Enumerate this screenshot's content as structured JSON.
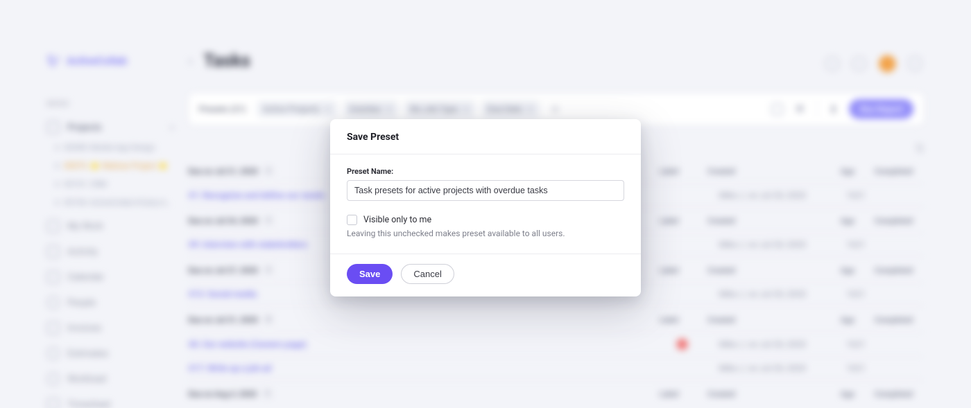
{
  "brand": "ActiveCollab",
  "page_title": "Tasks",
  "menu_label": "MENU",
  "nav": {
    "projects": "Projects",
    "sub": [
      "#2098: Mobile App Design",
      "#3075: ⭐ Webinar Project ⭐",
      "#3151: CRM",
      "#3194: ActiveCollab 8 Early A…"
    ],
    "my_work": "My Work",
    "activity": "Activity",
    "calendar": "Calendar",
    "people": "People",
    "invoices": "Invoices",
    "estimates": "Estimates",
    "workload": "Workload",
    "timesheet": "Timesheet"
  },
  "filter_bar": {
    "presets": "Presets (21)",
    "chips": [
      "Active Projects",
      "Overdue",
      "No Job Type",
      "Due Date"
    ],
    "run_report": "Run Report"
  },
  "columns": {
    "label": "Label",
    "created": "Created",
    "age": "Age",
    "completed": "Completed"
  },
  "groups": [
    {
      "title": "Due on Jul 21, 2020",
      "count": "1",
      "rows": [
        {
          "name": "#1: Recognize and define our needs",
          "created": "Mike J. on Jul 20, 2020",
          "age": "1621"
        }
      ]
    },
    {
      "title": "Due on Jul 24, 2020",
      "count": "1",
      "rows": [
        {
          "name": "#9: Interview with stakeholders",
          "created": "Mike J. on Jul 20, 2020",
          "age": "1621"
        }
      ]
    },
    {
      "title": "Due on Jul 27, 2020",
      "count": "1",
      "rows": [
        {
          "name": "#13: Social media",
          "created": "Mike J. on Jul 20, 2020",
          "age": "1621"
        }
      ]
    },
    {
      "title": "Due on Jul 31, 2020",
      "count": "2",
      "rows": [
        {
          "name": "#6: Our website (Careers page)",
          "created": "Mike J. on Jul 20, 2020",
          "age": "1621",
          "red": true
        },
        {
          "name": "#17: Write up a job ad",
          "created": "Mike J. on Jul 20, 2020",
          "age": "1621"
        }
      ]
    },
    {
      "title": "Due on Aug 4, 2020",
      "count": "1",
      "rows": []
    }
  ],
  "modal": {
    "title": "Save Preset",
    "field_label": "Preset Name:",
    "input_value": "Task presets for active projects with overdue tasks",
    "checkbox_label": "Visible only to me",
    "hint": "Leaving this unchecked makes preset available to all users.",
    "save": "Save",
    "cancel": "Cancel"
  }
}
